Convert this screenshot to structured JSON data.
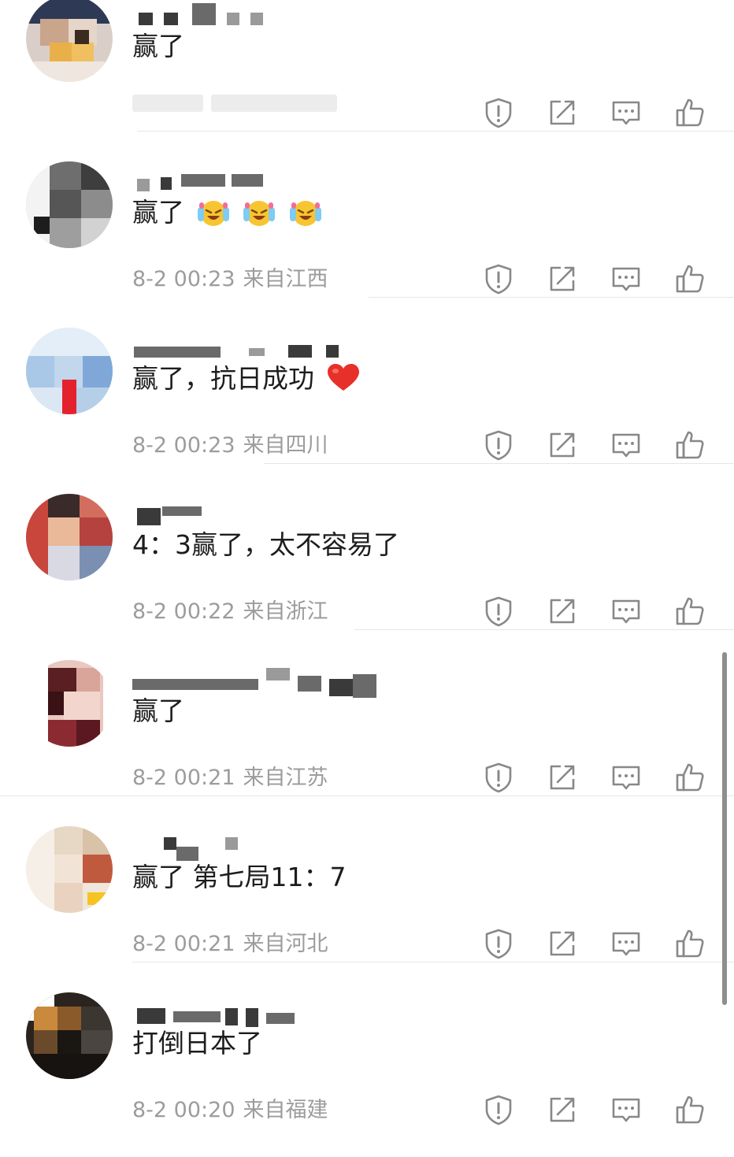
{
  "comments": [
    {
      "text": "赢了",
      "time": "",
      "location": "",
      "emoji_count": 0,
      "heart": false
    },
    {
      "text": "赢了",
      "time": "8-2 00:23",
      "location": "来自江西",
      "emoji_count": 3,
      "emoji_name": "laughing-crying-emoji",
      "heart": false
    },
    {
      "text": "赢了，抗日成功",
      "time": "8-2 00:23",
      "location": "来自四川",
      "emoji_count": 0,
      "heart": true,
      "heart_name": "red-heart-emoji"
    },
    {
      "text": "4：3赢了，太不容易了",
      "time": "8-2 00:22",
      "location": "来自浙江",
      "emoji_count": 0,
      "heart": false
    },
    {
      "text": "赢了",
      "time": "8-2 00:21",
      "location": "来自江苏",
      "emoji_count": 0,
      "heart": false
    },
    {
      "text": "赢了 第七局11：7",
      "time": "8-2 00:21",
      "location": "来自河北",
      "emoji_count": 0,
      "heart": false
    },
    {
      "text": "打倒日本了",
      "time": "8-2 00:20",
      "location": "来自福建",
      "emoji_count": 0,
      "heart": false
    }
  ],
  "actions": {
    "report_icon": "shield-alert-icon",
    "share_icon": "share-edit-icon",
    "reply_icon": "comment-bubble-icon",
    "like_icon": "thumbs-up-icon"
  },
  "colors": {
    "text": "#1d1d1d",
    "meta": "#9c9c9c",
    "icon": "#888888",
    "divider": "#e6e6e6",
    "heart": "#e8302a",
    "emoji": "#f7c531"
  }
}
